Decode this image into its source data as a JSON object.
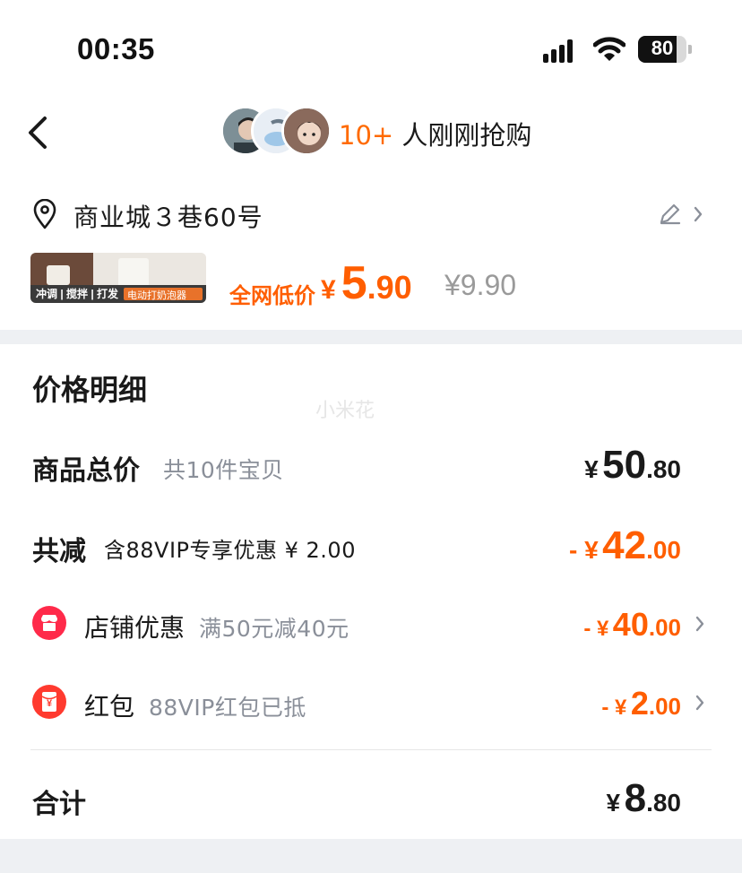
{
  "status_bar": {
    "time": "00:35",
    "battery": "80",
    "battery_level": 0.8
  },
  "header": {
    "buyers_count": "10+",
    "buyers_text": " 人刚刚抢购"
  },
  "address": {
    "text": "商业城３巷60号"
  },
  "product": {
    "thumb_tags": "冲调 | 搅拌 | 打发",
    "thumb_badge": "电动打奶泡器",
    "price_label": "全网低价",
    "price_yen": "¥",
    "price_int": "5",
    "price_dec": ".90",
    "original_price": "¥9.90"
  },
  "details": {
    "title": "价格明细",
    "watermark": "小米花",
    "total": {
      "label": "商品总价",
      "sub": "共10件宝贝",
      "yen": "¥",
      "int": "50",
      "dec": ".80"
    },
    "reduction": {
      "label": "共减",
      "note": "含88VIP专享优惠 ¥ 2.00",
      "prefix": "- ¥",
      "int": "42",
      "dec": ".00"
    },
    "store_discount": {
      "label": "店铺优惠",
      "sub": "满50元减40元",
      "prefix": "- ¥",
      "int": "40",
      "dec": ".00"
    },
    "red_packet": {
      "label": "红包",
      "sub": "88VIP红包已抵",
      "prefix": "- ¥",
      "int": "2",
      "dec": ".00",
      "icon_glyph": "¥"
    },
    "sum": {
      "label": "合计",
      "yen": "¥",
      "int": "8",
      "dec": ".80"
    }
  },
  "colors": {
    "accent": "#ff5e00",
    "muted": "#8a8f99",
    "band": "#eef0f3",
    "store_icon": "#ff2a4a"
  },
  "icons": [
    "back-chevron-icon",
    "location-pin-icon",
    "edit-pencil-icon",
    "chevron-right-icon",
    "store-icon",
    "red-packet-icon",
    "signal-icon",
    "wifi-icon",
    "battery-icon"
  ]
}
